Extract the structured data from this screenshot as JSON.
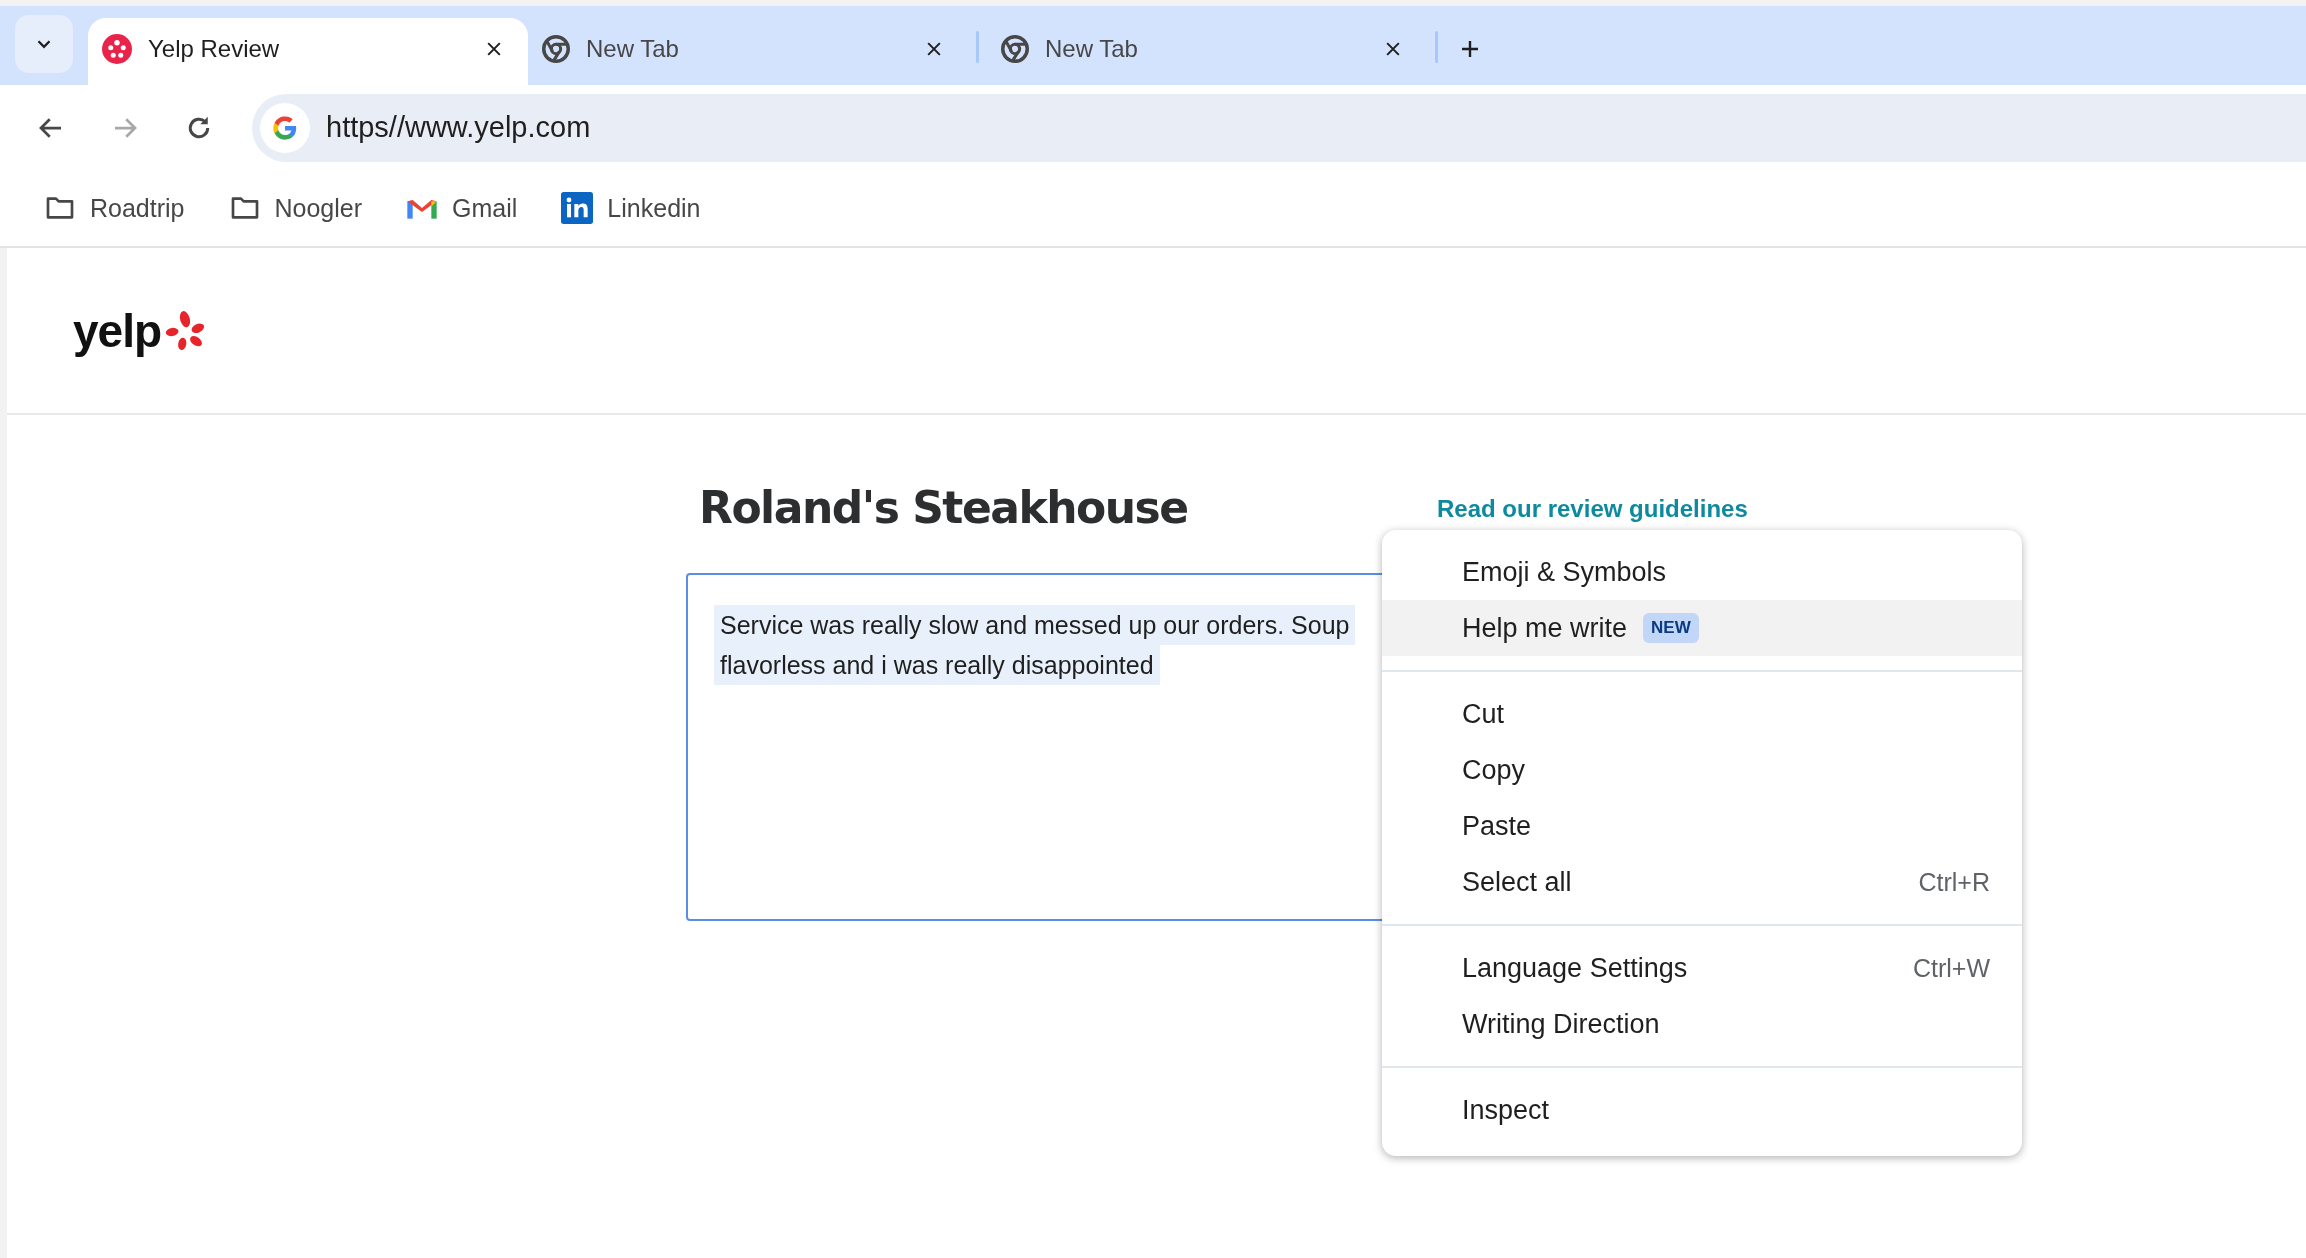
{
  "browser": {
    "tabs": [
      {
        "title": "Yelp Review",
        "kind": "yelp",
        "selected": true
      },
      {
        "title": "New Tab",
        "kind": "chrome",
        "selected": false
      },
      {
        "title": "New Tab",
        "kind": "chrome",
        "selected": false
      }
    ],
    "nav": {
      "back_disabled": false,
      "forward_disabled": true
    },
    "address": "https//www.yelp.com",
    "bookmarks": [
      {
        "label": "Roadtrip",
        "kind": "folder"
      },
      {
        "label": "Noogler",
        "kind": "folder"
      },
      {
        "label": "Gmail",
        "kind": "gmail"
      },
      {
        "label": "Linkedin",
        "kind": "linkedin"
      }
    ]
  },
  "page": {
    "logo": "yelp",
    "title": "Roland's Steakhouse",
    "guidelines_link": "Read our review guidelines",
    "review_lines": [
      "Service was really slow and messed up our orders. Soup",
      "flavorless and i was really disappointed"
    ]
  },
  "context_menu": {
    "sections": [
      [
        {
          "label": "Emoji & Symbols",
          "highlighted": false
        },
        {
          "label": "Help me write",
          "badge": "NEW",
          "highlighted": true
        }
      ],
      [
        {
          "label": "Cut",
          "highlighted": false
        },
        {
          "label": "Copy",
          "highlighted": false
        },
        {
          "label": "Paste",
          "highlighted": false
        },
        {
          "label": "Select all",
          "shortcut": "Ctrl+R",
          "highlighted": false
        }
      ],
      [
        {
          "label": "Language Settings",
          "shortcut": "Ctrl+W",
          "highlighted": false
        },
        {
          "label": "Writing Direction",
          "highlighted": false
        }
      ],
      [
        {
          "label": "Inspect",
          "highlighted": false
        }
      ]
    ]
  }
}
